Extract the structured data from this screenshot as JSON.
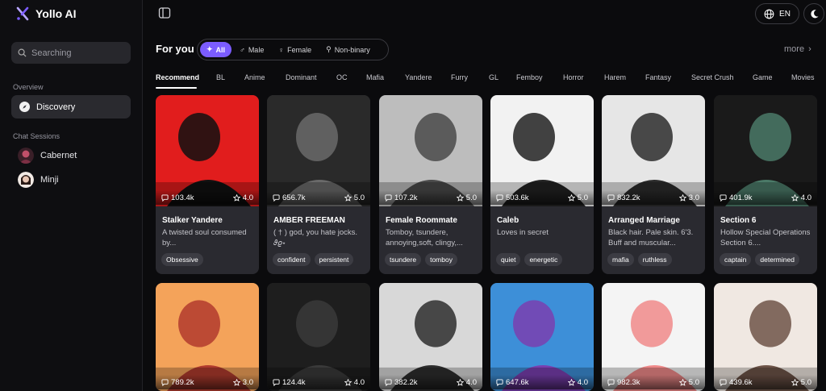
{
  "app": {
    "name": "Yollo AI"
  },
  "sidebar": {
    "search_placeholder": "Searching",
    "overview_label": "Overview",
    "discovery_label": "Discovery",
    "sessions_label": "Chat Sessions",
    "sessions": [
      {
        "name": "Cabernet",
        "avatar_color": "#c0506a"
      },
      {
        "name": "Minji",
        "avatar_color": "#d8b4a4"
      }
    ]
  },
  "topbar": {
    "language": "EN"
  },
  "foryou": {
    "title": "For you",
    "filters": [
      {
        "label": "All",
        "symbol": "✦",
        "active": true
      },
      {
        "label": "Male",
        "symbol": "♂",
        "active": false
      },
      {
        "label": "Female",
        "symbol": "♀",
        "active": false
      },
      {
        "label": "Non-binary",
        "symbol": "⚲",
        "active": false
      }
    ],
    "more_label": "more"
  },
  "categories": [
    "Recommend",
    "BL",
    "Anime",
    "Dominant",
    "OC",
    "Mafia",
    "Yandere",
    "Furry",
    "GL",
    "Femboy",
    "Horror",
    "Harem",
    "Fantasy",
    "Secret Crush",
    "Game",
    "Movies"
  ],
  "cards_row1": [
    {
      "chats": "103.4k",
      "rating": "4.0",
      "name": "Stalker Yandere",
      "desc": "A twisted soul consumed by...",
      "tags": [
        "Obsessive"
      ],
      "palette": [
        "#e11d1d",
        "#111111"
      ]
    },
    {
      "chats": "656.7k",
      "rating": "5.0",
      "name": "AMBER FREEMAN",
      "desc": "( † ) god, you hate jocks. 𝜗𝜚⋆",
      "tags": [
        "confident",
        "persistent"
      ],
      "palette": [
        "#2a2a2a",
        "#6a6a6a"
      ]
    },
    {
      "chats": "107.2k",
      "rating": "5.0",
      "name": "Female Roommate",
      "desc": "Tomboy, tsundere, annoying,soft, clingy,...",
      "tags": [
        "tsundere",
        "tomboy"
      ],
      "palette": [
        "#bdbdbd",
        "#4a4a4a"
      ]
    },
    {
      "chats": "503.6k",
      "rating": "5.0",
      "name": "Caleb",
      "desc": "Loves in secret",
      "tags": [
        "quiet",
        "energetic"
      ],
      "palette": [
        "#f2f2f2",
        "#222222"
      ]
    },
    {
      "chats": "832.2k",
      "rating": "3.0",
      "name": "Arranged Marriage",
      "desc": "Black hair. Pale skin. 6'3. Buff and muscular...",
      "tags": [
        "mafia",
        "ruthless"
      ],
      "palette": [
        "#e6e6e6",
        "#2b2b2b"
      ]
    },
    {
      "chats": "401.9k",
      "rating": "4.0",
      "name": "Section 6",
      "desc": "Hollow Special Operations Section 6....",
      "tags": [
        "captain",
        "determined"
      ],
      "palette": [
        "#1a1a1a",
        "#4b7a68"
      ]
    }
  ],
  "cards_row2": [
    {
      "chats": "789.2k",
      "rating": "3.0",
      "palette": [
        "#f4a35a",
        "#b13b2e"
      ]
    },
    {
      "chats": "124.4k",
      "rating": "4.0",
      "palette": [
        "#1e1e1e",
        "#3a3a3a"
      ]
    },
    {
      "chats": "382.2k",
      "rating": "4.0",
      "palette": [
        "#d8d8d8",
        "#2e2e2e"
      ]
    },
    {
      "chats": "647.6k",
      "rating": "4.0",
      "palette": [
        "#3d8fd8",
        "#7a3fb0"
      ]
    },
    {
      "chats": "982.3k",
      "rating": "5.0",
      "palette": [
        "#f4f4f4",
        "#f08a8a"
      ]
    },
    {
      "chats": "439.6k",
      "rating": "5.0",
      "palette": [
        "#f0e8e2",
        "#6e5448"
      ]
    }
  ],
  "colors": {
    "accent": "#7b5cff"
  }
}
